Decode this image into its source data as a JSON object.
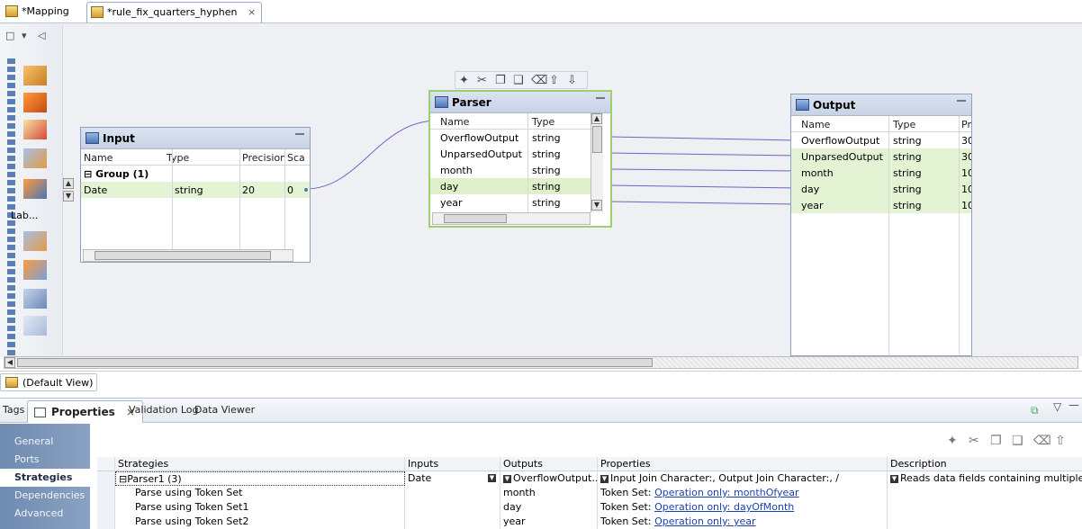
{
  "editor_tabs": [
    {
      "label": "*Mapping"
    },
    {
      "label": "*rule_fix_quarters_hyphen",
      "close": "×"
    }
  ],
  "palette": {
    "label": "Lab..."
  },
  "input_box": {
    "title": "Input",
    "columns": [
      "Name",
      "Type",
      "Precision",
      "Sca"
    ],
    "group": "Group (1)",
    "rows": [
      {
        "name": "Date",
        "type": "string",
        "precision": "20",
        "scale": "0"
      }
    ]
  },
  "parser_box": {
    "title": "Parser",
    "columns": [
      "Name",
      "Type"
    ],
    "rows": [
      {
        "name": "OverflowOutput",
        "type": "string"
      },
      {
        "name": "UnparsedOutput",
        "type": "string"
      },
      {
        "name": "month",
        "type": "string"
      },
      {
        "name": "day",
        "type": "string"
      },
      {
        "name": "year",
        "type": "string"
      }
    ]
  },
  "output_box": {
    "title": "Output",
    "columns": [
      "Name",
      "Type",
      "Pre"
    ],
    "rows": [
      {
        "name": "OverflowOutput",
        "type": "string",
        "precision": "30"
      },
      {
        "name": "UnparsedOutput",
        "type": "string",
        "precision": "30"
      },
      {
        "name": "month",
        "type": "string",
        "precision": "10"
      },
      {
        "name": "day",
        "type": "string",
        "precision": "10"
      },
      {
        "name": "year",
        "type": "string",
        "precision": "10"
      }
    ]
  },
  "view": {
    "label": "(Default View)"
  },
  "panel_tabs": [
    {
      "label": "Tags"
    },
    {
      "label": "Properties",
      "close": "×"
    },
    {
      "label": "Validation Log"
    },
    {
      "label": "Data Viewer"
    }
  ],
  "side_nav": [
    {
      "label": "General"
    },
    {
      "label": "Ports"
    },
    {
      "label": "Strategies"
    },
    {
      "label": "Dependencies"
    },
    {
      "label": "Advanced"
    }
  ],
  "grid": {
    "headers": [
      "Strategies",
      "Inputs",
      "Outputs",
      "Properties",
      "Description"
    ],
    "rows": [
      {
        "strategy": "Parser1 (3)",
        "inputs": "Date",
        "outputs": "OverflowOutput...",
        "properties": "Input Join Character:, Output Join Character:, /",
        "description": "Reads data fields containing multiple info..."
      },
      {
        "strategy": "Parse using Token Set",
        "inputs": "",
        "outputs": "month",
        "prop_prefix": "Token Set:",
        "prop_link": "Operation only: monthOfyear",
        "description": ""
      },
      {
        "strategy": "Parse using Token Set1",
        "inputs": "",
        "outputs": "day",
        "prop_prefix": "Token Set:",
        "prop_link": "Operation only: dayOfMonth",
        "description": ""
      },
      {
        "strategy": "Parse using Token Set2",
        "inputs": "",
        "outputs": "year",
        "prop_prefix": "Token Set:",
        "prop_link": "Operation only: year",
        "description": ""
      }
    ]
  },
  "colors": {
    "accent": "#6f8bb0",
    "row_highlight": "#e4f3d4",
    "link": "#1a3fb8"
  }
}
